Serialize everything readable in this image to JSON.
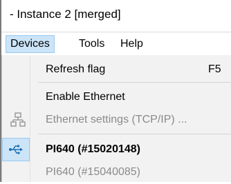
{
  "window": {
    "title": "- Instance 2 [merged]"
  },
  "menubar": {
    "items": [
      {
        "label": "Devices"
      },
      {
        "label": "Tools"
      },
      {
        "label": "Help"
      }
    ]
  },
  "dropdown": {
    "items": [
      {
        "label": "Refresh flag",
        "shortcut": "F5"
      },
      {
        "label": "Enable Ethernet"
      },
      {
        "label": "Ethernet settings (TCP/IP) ...",
        "icon": "network-icon"
      },
      {
        "label": "PI640  (#15020148)",
        "icon": "usb-icon"
      },
      {
        "label": "PI640  (#15040085)"
      }
    ]
  },
  "colors": {
    "highlight": "#cce4f7",
    "highlight_border": "#99c9ef",
    "disabled_text": "#8a8a8a",
    "icon_blue": "#1a6fb5",
    "icon_gray": "#9a9a9a"
  }
}
